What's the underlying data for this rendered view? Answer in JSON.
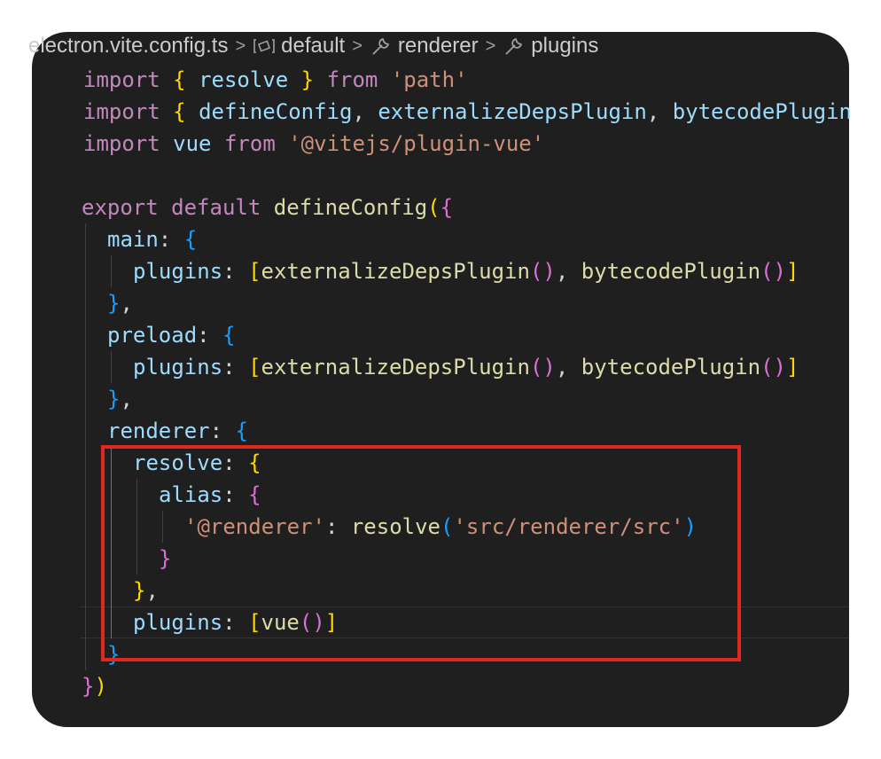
{
  "breadcrumb": {
    "file": "electron.vite.config.ts",
    "items": [
      {
        "label": "default",
        "icon": "module-icon"
      },
      {
        "label": "renderer",
        "icon": "wrench-icon"
      },
      {
        "label": "plugins",
        "icon": "wrench-icon"
      }
    ],
    "separator": ">"
  },
  "code": {
    "lines": [
      "import { resolve } from 'path'",
      "import { defineConfig, externalizeDepsPlugin, bytecodePlugin",
      "import vue from '@vitejs/plugin-vue'",
      "",
      "export default defineConfig({",
      "  main: {",
      "    plugins: [externalizeDepsPlugin(), bytecodePlugin()]",
      "  },",
      "  preload: {",
      "    plugins: [externalizeDepsPlugin(), bytecodePlugin()]",
      "  },",
      "  renderer: {",
      "    resolve: {",
      "      alias: {",
      "        '@renderer': resolve('src/renderer/src')",
      "      }",
      "    },",
      "    plugins: [vue()]",
      "  }",
      "})"
    ]
  },
  "colors": {
    "background": "#1f1f1f",
    "keyword": "#c586c0",
    "identifier": "#9cdcfe",
    "function": "#dcdcaa",
    "string": "#ce9178",
    "bracket_level1": "#ffd700",
    "bracket_level2": "#da70d6",
    "bracket_level3": "#179fff",
    "highlight_box": "#e0281e"
  }
}
